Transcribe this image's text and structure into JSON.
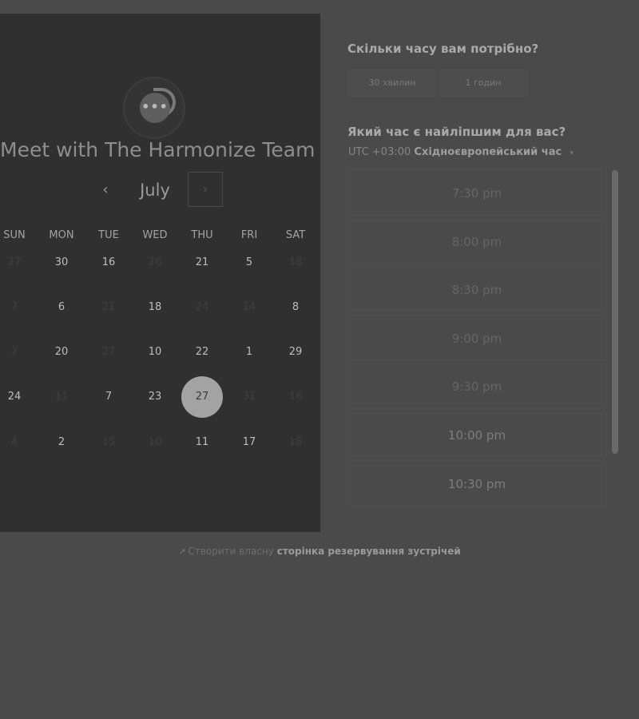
{
  "calendar": {
    "title": "Meet with The Harmonize Team",
    "month": "July",
    "prev_label": "‹",
    "next_label": "›",
    "logo_dots": "•••",
    "weekdays": [
      "SUN",
      "MON",
      "TUE",
      "WED",
      "THU",
      "FRI",
      "SAT"
    ],
    "weeks": [
      [
        {
          "d": "27",
          "dim": true
        },
        {
          "d": "30",
          "dim": false
        },
        {
          "d": "16",
          "dim": false
        },
        {
          "d": "26",
          "dim": true
        },
        {
          "d": "21",
          "dim": false
        },
        {
          "d": "5",
          "dim": false
        },
        {
          "d": "18",
          "dim": true
        }
      ],
      [
        {
          "d": "7",
          "dim": true
        },
        {
          "d": "6",
          "dim": false
        },
        {
          "d": "21",
          "dim": true
        },
        {
          "d": "18",
          "dim": false
        },
        {
          "d": "24",
          "dim": true
        },
        {
          "d": "14",
          "dim": true
        },
        {
          "d": "8",
          "dim": false
        }
      ],
      [
        {
          "d": "2",
          "dim": true
        },
        {
          "d": "20",
          "dim": false
        },
        {
          "d": "27",
          "dim": true
        },
        {
          "d": "10",
          "dim": false
        },
        {
          "d": "22",
          "dim": false
        },
        {
          "d": "1",
          "dim": false
        },
        {
          "d": "29",
          "dim": false
        }
      ],
      [
        {
          "d": "24",
          "dim": false
        },
        {
          "d": "11",
          "dim": true
        },
        {
          "d": "7",
          "dim": false
        },
        {
          "d": "23",
          "dim": false
        },
        {
          "d": "27",
          "dim": false,
          "selected": true
        },
        {
          "d": "31",
          "dim": true
        },
        {
          "d": "16",
          "dim": true
        }
      ],
      [
        {
          "d": "4",
          "dim": true
        },
        {
          "d": "2",
          "dim": false
        },
        {
          "d": "15",
          "dim": true
        },
        {
          "d": "10",
          "dim": true
        },
        {
          "d": "11",
          "dim": false
        },
        {
          "d": "17",
          "dim": false
        },
        {
          "d": "18",
          "dim": true
        }
      ]
    ]
  },
  "duration": {
    "question": "Скільки часу вам потрібно?",
    "options": [
      "30 хвилин",
      "1 годин"
    ]
  },
  "time": {
    "question": "Який час є найліпшим для вас?",
    "tz_offset": "UTC +03:00",
    "tz_name": "Східноєвропейський час",
    "caret": "▾",
    "slots": [
      "7:30 pm",
      "8:00 pm",
      "8:30 pm",
      "9:00 pm",
      "9:30 pm",
      "10:00 pm",
      "10:30 pm"
    ]
  },
  "footer": {
    "icon": "↗",
    "prefix": "Створити власну",
    "link": "сторінка резервування зустрічей"
  }
}
